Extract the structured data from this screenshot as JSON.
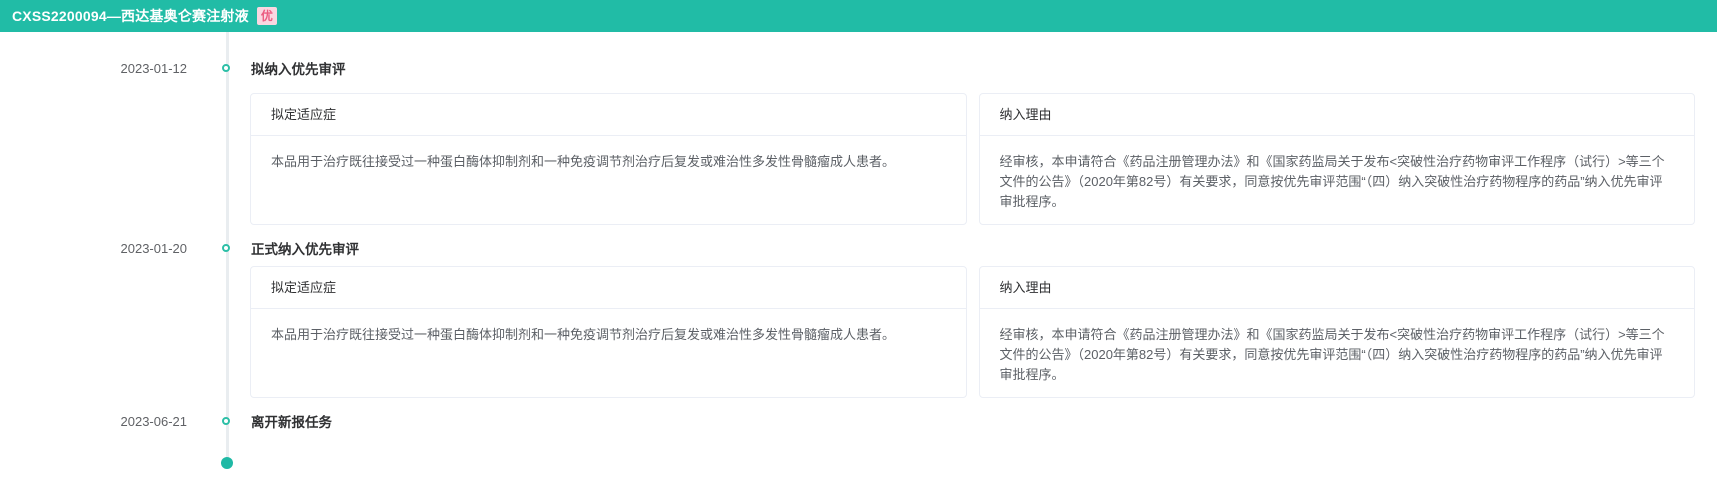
{
  "header": {
    "title": "CXSS2200094—西达基奥仑赛注射液",
    "badge": "优"
  },
  "timeline": {
    "items": [
      {
        "date": "2023-01-12",
        "title": "拟纳入优先审评",
        "cards": [
          {
            "header": "拟定适应症",
            "body": "本品用于治疗既往接受过一种蛋白酶体抑制剂和一种免疫调节剂治疗后复发或难治性多发性骨髓瘤成人患者。"
          },
          {
            "header": "纳入理由",
            "body": "经审核，本申请符合《药品注册管理办法》和《国家药监局关于发布<突破性治疗药物审评工作程序（试行）>等三个文件的公告》（2020年第82号）有关要求，同意按优先审评范围“（四）纳入突破性治疗药物程序的药品”纳入优先审评审批程序。"
          }
        ]
      },
      {
        "date": "2023-01-20",
        "title": "正式纳入优先审评",
        "cards": [
          {
            "header": "拟定适应症",
            "body": "本品用于治疗既往接受过一种蛋白酶体抑制剂和一种免疫调节剂治疗后复发或难治性多发性骨髓瘤成人患者。"
          },
          {
            "header": "纳入理由",
            "body": "经审核，本申请符合《药品注册管理办法》和《国家药监局关于发布<突破性治疗药物审评工作程序（试行）>等三个文件的公告》（2020年第82号）有关要求，同意按优先审评范围“（四）纳入突破性治疗药物程序的药品”纳入优先审评审批程序。"
          }
        ]
      },
      {
        "date": "2023-06-21",
        "title": "离开新报任务"
      }
    ]
  },
  "colors": {
    "header_background": "#21bca6",
    "badge_background": "#fad7e1",
    "badge_text": "#eb5c81",
    "timeline_line": "#e9edf0",
    "timeline_marker": "#2dbfa7",
    "timeline_end_dot": "#1fb9a5",
    "card_border": "#ebeef5"
  }
}
